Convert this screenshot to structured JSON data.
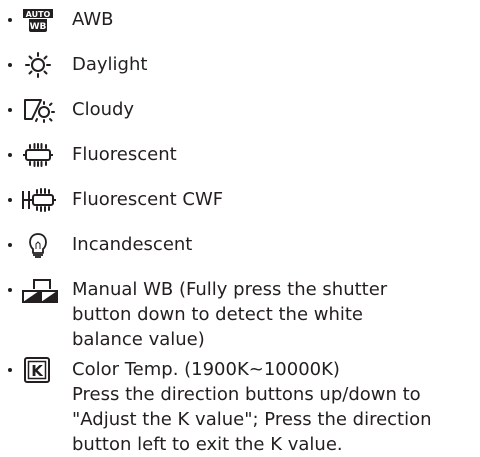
{
  "list": {
    "items": [
      {
        "icon": "awb-icon",
        "lines": [
          "AWB"
        ]
      },
      {
        "icon": "daylight-sun-icon",
        "lines": [
          "Daylight"
        ]
      },
      {
        "icon": "cloudy-icon",
        "lines": [
          "Cloudy"
        ]
      },
      {
        "icon": "fluorescent-icon",
        "lines": [
          "Fluorescent"
        ]
      },
      {
        "icon": "fluorescent-cwf-icon",
        "lines": [
          "Fluorescent CWF"
        ]
      },
      {
        "icon": "incandescent-bulb-icon",
        "lines": [
          "Incandescent"
        ]
      },
      {
        "icon": "manual-wb-icon",
        "lines": [
          "Manual WB (Fully press the shutter",
          "button down to detect the white",
          "balance value)"
        ]
      },
      {
        "icon": "color-temp-k-icon",
        "lines": [
          "Color Temp. (1900K~10000K)",
          "Press the direction buttons up/down to",
          "\"Adjust the K value\"; Press the direction",
          "button left to exit the K value."
        ]
      }
    ]
  },
  "icon_labels": {
    "auto": "AUTO",
    "wb": "WB",
    "k": "K"
  },
  "colors": {
    "text": "#231f20",
    "background": "#ffffff"
  }
}
